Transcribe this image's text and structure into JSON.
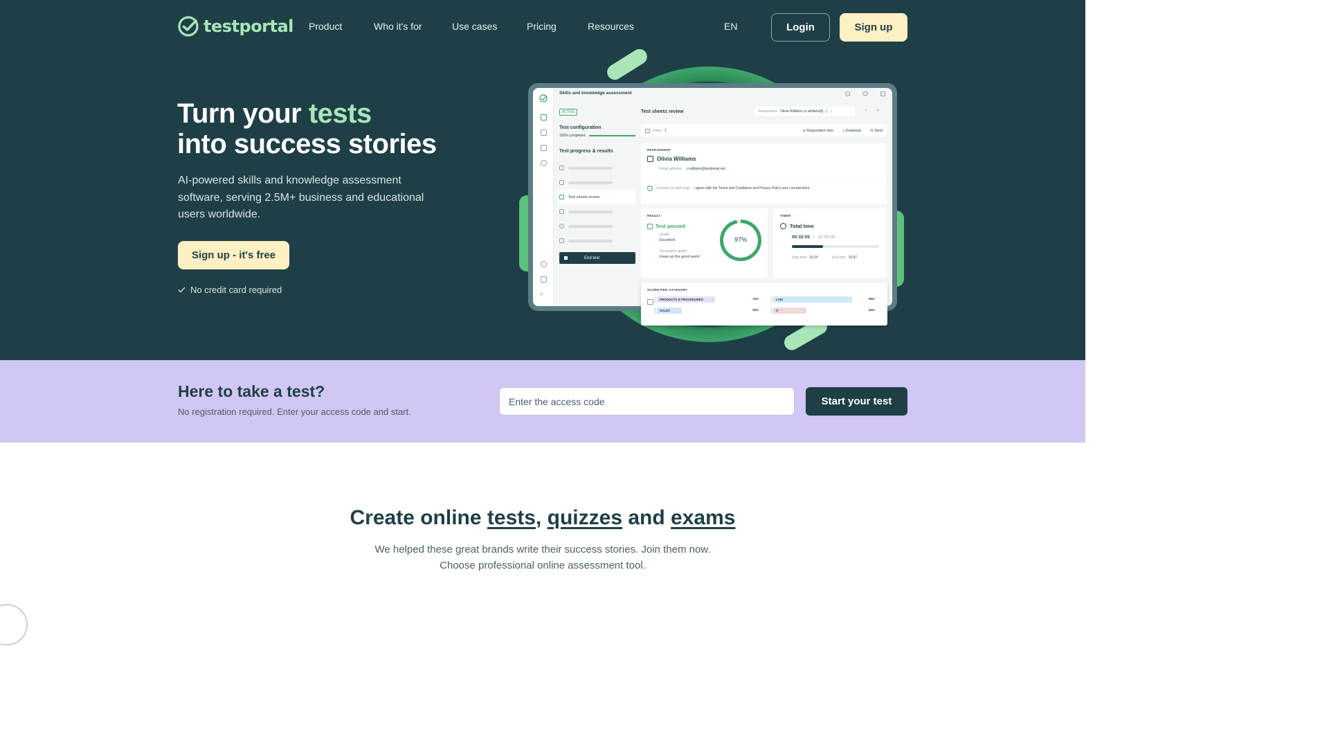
{
  "nav": {
    "logo_text": "testportal",
    "links": [
      "Product",
      "Who it's for",
      "Use cases",
      "Pricing",
      "Resources"
    ],
    "language": "EN",
    "login_label": "Login",
    "signup_label": "Sign up"
  },
  "hero": {
    "title_part1": "Turn your",
    "title_accent": "tests",
    "title_line2": "into success stories",
    "subtitle": "AI-powered skills and knowledge assessment software, serving 2.5M+ business and educational users worldwide.",
    "cta_label": "Sign up - it's free",
    "no_cc_text": "No credit card required"
  },
  "mockup": {
    "header_title": "Skills and knowledge assessment",
    "status_pill": "ACTIVE",
    "config_label": "Test configuration",
    "config_progress": "100% completed",
    "progress_label": "Test progress & results",
    "active_item": "Test sheets review",
    "end_test": "End test",
    "review_title": "Test sheets review",
    "respondent_select_label": "Respondent",
    "respondent_select_value": "Olivia Williams (o.williams@...)",
    "dates_label": "Dates",
    "dates_value": "1",
    "respondent_view": "Respondent view",
    "download": "Download",
    "send": "Send",
    "respondent_heading": "RESPONDENT",
    "respondent_name": "Olivia Williams",
    "email_label": "Email address",
    "email_value": "o.williams@testportal.net",
    "consent_label": "Consent on start page",
    "consent_text": "I agree with the Terms and Conditions and Privacy Policy and I accept them.",
    "result_heading": "RESULT",
    "result_status": "Test passed",
    "grade_label": "Grade",
    "grade_value": "Excellent",
    "desc_grade_label": "Descriptive grade",
    "desc_grade_value": "Keep up the good work!",
    "score_percent": "97%",
    "score_fraction": 0.97,
    "timer_heading": "TIMER",
    "timer_title": "Total time",
    "timer_value": "00:32:05",
    "timer_separator": "/",
    "timer_limit": "01:30:00",
    "timer_fraction": 0.36,
    "start_label": "Start time",
    "start_value": "10:15",
    "end_label": "End time",
    "end_value": "10:47",
    "categories_heading": "SCORE PER CATEGORY",
    "categories": [
      {
        "name": "PRODUCTS & PROCEDURES",
        "value": "70%",
        "fraction": 0.7,
        "color": "#e7dcf6"
      },
      {
        "name": "LAW",
        "value": "95%",
        "fraction": 0.95,
        "color": "#cfe9f6"
      },
      {
        "name": "SALES",
        "value": "30%",
        "fraction": 0.3,
        "color": "#d6e3fb"
      },
      {
        "name": "IT",
        "value": "40%",
        "fraction": 0.4,
        "color": "#f1d9d9"
      }
    ]
  },
  "test_band": {
    "title": "Here to take a test?",
    "subtitle": "No registration required. Enter your access code and start.",
    "input_placeholder": "Enter the access code",
    "start_label": "Start your test"
  },
  "create": {
    "title_prefix": "Create online",
    "link_tests": "tests",
    "comma": ",",
    "link_quizzes": "quizzes",
    "and": "and",
    "link_exams": "exams",
    "subtitle_line1": "We helped these great brands write their success stories. Join them now.",
    "subtitle_line2": "Choose professional online assessment tool."
  },
  "colors": {
    "hero_bg": "#1f3f47",
    "accent_green": "#a8e6b8",
    "cta_yellow": "#fdf0c2",
    "band_purple": "#d1c6f4"
  },
  "icons": [
    "testportal-logo-icon",
    "check-icon"
  ]
}
